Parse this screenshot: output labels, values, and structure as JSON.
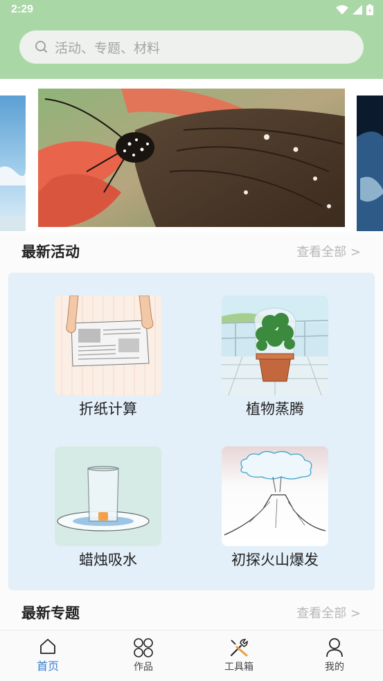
{
  "status_bar": {
    "time": "2:29"
  },
  "search": {
    "placeholder": "活动、专题、材料"
  },
  "sections": {
    "latest_activities": {
      "title": "最新活动",
      "more": "查看全部 >"
    },
    "latest_topics": {
      "title": "最新专题",
      "more": "查看全部 >"
    }
  },
  "activities": [
    {
      "label": "折纸计算",
      "icon": "newspaper-illustration"
    },
    {
      "label": "植物蒸腾",
      "icon": "potted-plant-illustration"
    },
    {
      "label": "蜡烛吸水",
      "icon": "candle-glass-illustration"
    },
    {
      "label": "初探火山爆发",
      "icon": "volcano-illustration"
    }
  ],
  "bottom_nav": [
    {
      "label": "首页",
      "icon": "home-icon",
      "active": true
    },
    {
      "label": "作品",
      "icon": "grid-icon",
      "active": false
    },
    {
      "label": "工具箱",
      "icon": "tools-icon",
      "active": false
    },
    {
      "label": "我的",
      "icon": "person-icon",
      "active": false
    }
  ],
  "colors": {
    "header": "#a9d7a6",
    "panel": "#e3eff9",
    "nav_active": "#3a7fd0"
  }
}
